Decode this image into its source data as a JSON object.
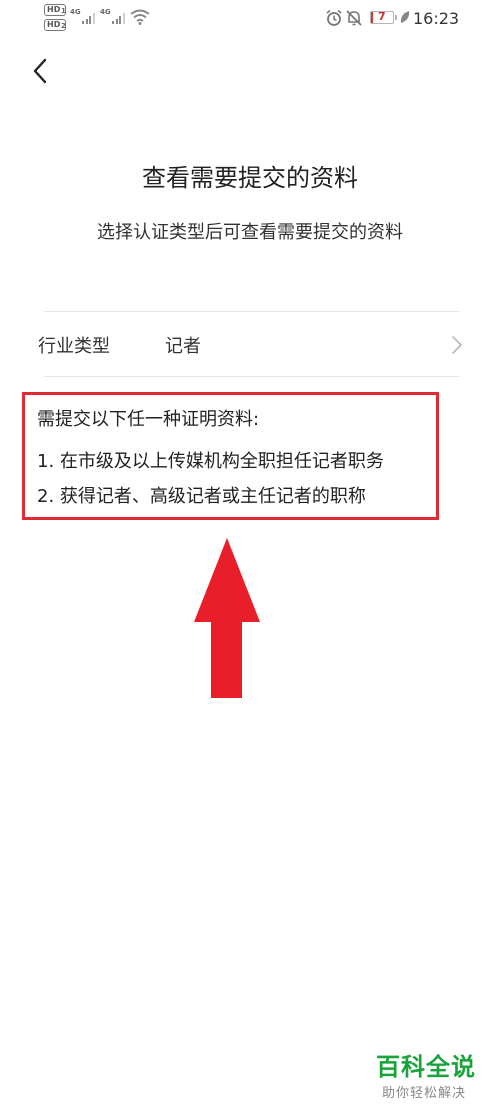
{
  "status_bar": {
    "time": "16:23",
    "battery_level": "7",
    "network_type_1": "4G",
    "network_type_2": "4G",
    "hd_badge_1": "HD",
    "hd_badge_2": "HD",
    "sim_1": "1",
    "sim_2": "2"
  },
  "nav": {
    "back_icon": "chevron-left-icon"
  },
  "main": {
    "title": "查看需要提交的资料",
    "subtitle": "选择认证类型后可查看需要提交的资料",
    "industry_row": {
      "label": "行业类型",
      "value": "记者",
      "icon": "chevron-right-icon"
    },
    "requirements": {
      "heading": "需提交以下任一种证明资料:",
      "items": [
        "1. 在市级及以上传媒机构全职担任记者职务",
        "2. 获得记者、高级记者或主任记者的职称"
      ]
    }
  },
  "annotation": {
    "arrow_color": "#e81e2a",
    "box_color": "#e02b33"
  },
  "watermark": {
    "title": "百科全说",
    "subtitle": "助你轻松解决",
    "color": "#1aa33a"
  }
}
